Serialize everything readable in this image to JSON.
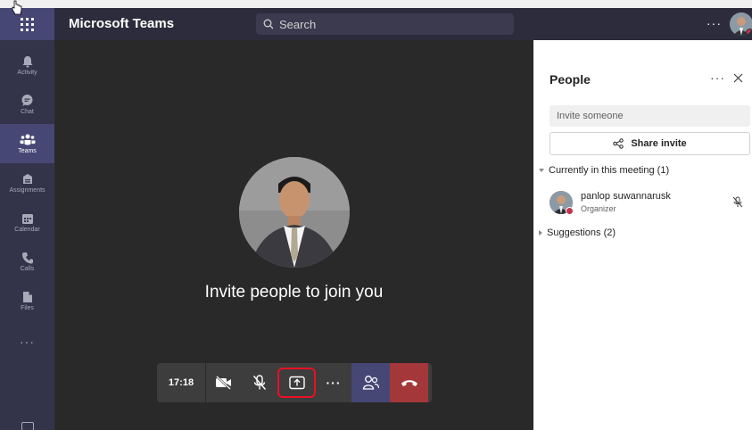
{
  "app": {
    "title": "Microsoft Teams"
  },
  "search": {
    "placeholder": "Search"
  },
  "topbar": {
    "more": "···"
  },
  "rail": {
    "items": [
      {
        "label": "Activity",
        "icon": "bell-icon"
      },
      {
        "label": "Chat",
        "icon": "chat-icon"
      },
      {
        "label": "Teams",
        "icon": "teams-icon"
      },
      {
        "label": "Assignments",
        "icon": "assignments-icon"
      },
      {
        "label": "Calendar",
        "icon": "calendar-icon"
      },
      {
        "label": "Calls",
        "icon": "phone-icon"
      },
      {
        "label": "Files",
        "icon": "file-icon"
      }
    ],
    "active": "Teams",
    "more": "···"
  },
  "stage": {
    "message": "Invite people to join you"
  },
  "controls": {
    "timer": "17:18",
    "more": "···"
  },
  "panel": {
    "title": "People",
    "more": "···",
    "invite_placeholder": "Invite someone",
    "share_label": "Share invite",
    "current_section": "Currently in this meeting (1)",
    "suggestions_section": "Suggestions (2)",
    "member": {
      "name": "panlop suwannarusk",
      "role": "Organizer"
    }
  },
  "colors": {
    "topbar": "#2d2c3c",
    "rail": "#33344a",
    "accent": "#464775",
    "stage": "#292929",
    "hangup": "#a4373a",
    "highlight": "#e81123"
  }
}
